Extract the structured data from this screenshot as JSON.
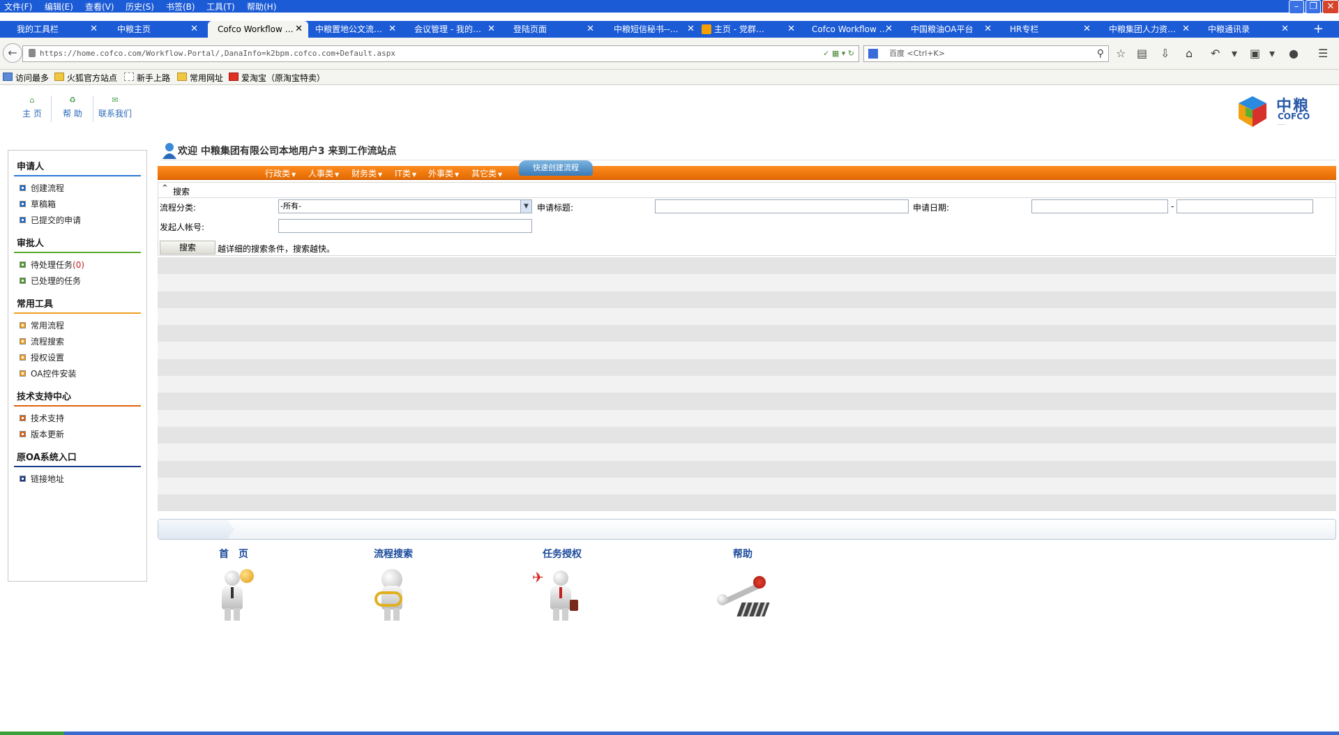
{
  "browser": {
    "menu": [
      "文件(F)",
      "编辑(E)",
      "查看(V)",
      "历史(S)",
      "书签(B)",
      "工具(T)",
      "帮助(H)"
    ],
    "tabs": [
      {
        "label": "我的工具栏",
        "active": false
      },
      {
        "label": "中粮主页",
        "active": false
      },
      {
        "label": "Cofco Workflow …",
        "active": true
      },
      {
        "label": "中粮置地公文流…",
        "active": false
      },
      {
        "label": "会议管理 - 我的…",
        "active": false
      },
      {
        "label": "登陆页面",
        "active": false
      },
      {
        "label": "中粮短信秘书--…",
        "active": false
      },
      {
        "label": "主页 - 党群…",
        "active": false
      },
      {
        "label": "Cofco Workflow …",
        "active": false
      },
      {
        "label": "中国粮油OA平台",
        "active": false
      },
      {
        "label": "HR专栏",
        "active": false
      },
      {
        "label": "中粮集团人力资…",
        "active": false
      },
      {
        "label": "中粮通讯录",
        "active": false
      }
    ],
    "url": "https://home.cofco.com/Workflow.Portal/,DanaInfo=k2bpm.cofco.com+Default.aspx",
    "search_engine": "百度",
    "search_placeholder": "百度 <Ctrl+K>",
    "bookmarks": [
      "访问最多",
      "火狐官方站点",
      "新手上路",
      "常用网址",
      "爱淘宝（原淘宝特卖）"
    ]
  },
  "header": {
    "nav": [
      {
        "label": "主 页",
        "icon": "home-icon"
      },
      {
        "label": "帮 助",
        "icon": "help-icon"
      },
      {
        "label": "联系我们",
        "icon": "mail-icon"
      }
    ],
    "logo": {
      "cn": "中粮",
      "en": "COFCO"
    }
  },
  "sidebar": {
    "groups": [
      {
        "title": "申请人",
        "color": "#2a7ad8",
        "bullet": "#1a6ac8",
        "items": [
          {
            "label": "创建流程"
          },
          {
            "label": "草稿箱"
          },
          {
            "label": "已提交的申请"
          }
        ]
      },
      {
        "title": "审批人",
        "color": "#5aaa2a",
        "bullet": "#4a9a2a",
        "items": [
          {
            "label": "待处理任务",
            "count": "(0)"
          },
          {
            "label": "已处理的任务"
          }
        ]
      },
      {
        "title": "常用工具",
        "color": "#f0a020",
        "bullet": "#f0a020",
        "items": [
          {
            "label": "常用流程"
          },
          {
            "label": "流程搜索"
          },
          {
            "label": "授权设置"
          },
          {
            "label": "OA控件安装"
          }
        ]
      },
      {
        "title": "技术支持中心",
        "color": "#e06010",
        "bullet": "#e06010",
        "items": [
          {
            "label": "技术支持"
          },
          {
            "label": "版本更新"
          }
        ]
      },
      {
        "title": "原OA系统入口",
        "color": "#1a3a8a",
        "bullet": "#1a3a8a",
        "items": [
          {
            "label": "链接地址"
          }
        ]
      }
    ]
  },
  "main": {
    "welcome": "欢迎 中粮集团有限公司本地用户3 来到工作流站点",
    "categories": [
      "行政类",
      "人事类",
      "财务类",
      "IT类",
      "外事类",
      "其它类"
    ],
    "quick_create": "快速创建流程",
    "search": {
      "title": "搜索",
      "category_label": "流程分类:",
      "category_value": "-所有-",
      "subject_label": "申请标题:",
      "subject_value": "",
      "date_label": "申请日期:",
      "date_from": "",
      "date_to": "",
      "date_sep": "-",
      "initiator_label": "发起人帐号:",
      "initiator_value": "",
      "button": "搜索",
      "hint": "越详细的搜索条件，搜索越快。"
    },
    "quick_links": [
      {
        "label": "首　页",
        "icon": "globe-person-icon"
      },
      {
        "label": "流程搜索",
        "icon": "magnifier-person-icon"
      },
      {
        "label": "任务授权",
        "icon": "traveler-person-icon"
      },
      {
        "label": "帮助",
        "icon": "gear-person-icon"
      }
    ]
  }
}
